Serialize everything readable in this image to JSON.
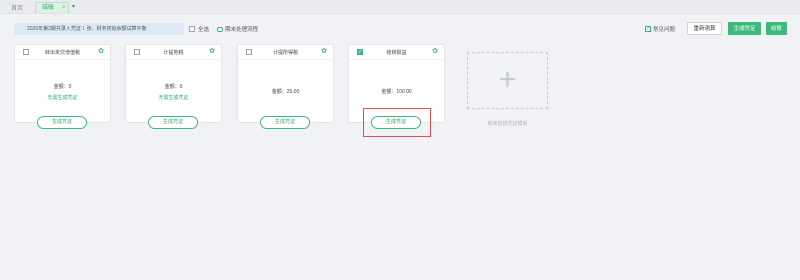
{
  "tabs": {
    "home": "首页",
    "active": "结账",
    "close": "×",
    "menu": "▾"
  },
  "toolbar": {
    "notice_prefix": "2020年第2期共录入凭证",
    "notice_count": "1",
    "notice_suffix": "张，财务初始余额试算平衡",
    "check_all": "全选",
    "flow": "期末处理流程",
    "faq": "常见问题",
    "btn_retest": "重新测算",
    "btn_generate": "生成凭证",
    "btn_close": "结账"
  },
  "cards": [
    {
      "title": "转出未交增值税",
      "amount": "金额：0",
      "sub": "无需生成凭证",
      "button": "生成凭证",
      "checked": false
    },
    {
      "title": "计提地税",
      "amount": "金额：0",
      "sub": "无需生成凭证",
      "button": "生成凭证",
      "checked": false
    },
    {
      "title": "计提所得税",
      "amount": "金额：25.00",
      "sub": "",
      "button": "生成凭证",
      "checked": false
    },
    {
      "title": "结转损益",
      "amount": "金额：100.00",
      "sub": "",
      "button": "生成凭证",
      "checked": true
    }
  ],
  "add_template": {
    "plus": "+",
    "label": "期末结转凭证模板"
  },
  "colors": {
    "accent": "#3dba7b",
    "highlight": "#e5484d"
  }
}
